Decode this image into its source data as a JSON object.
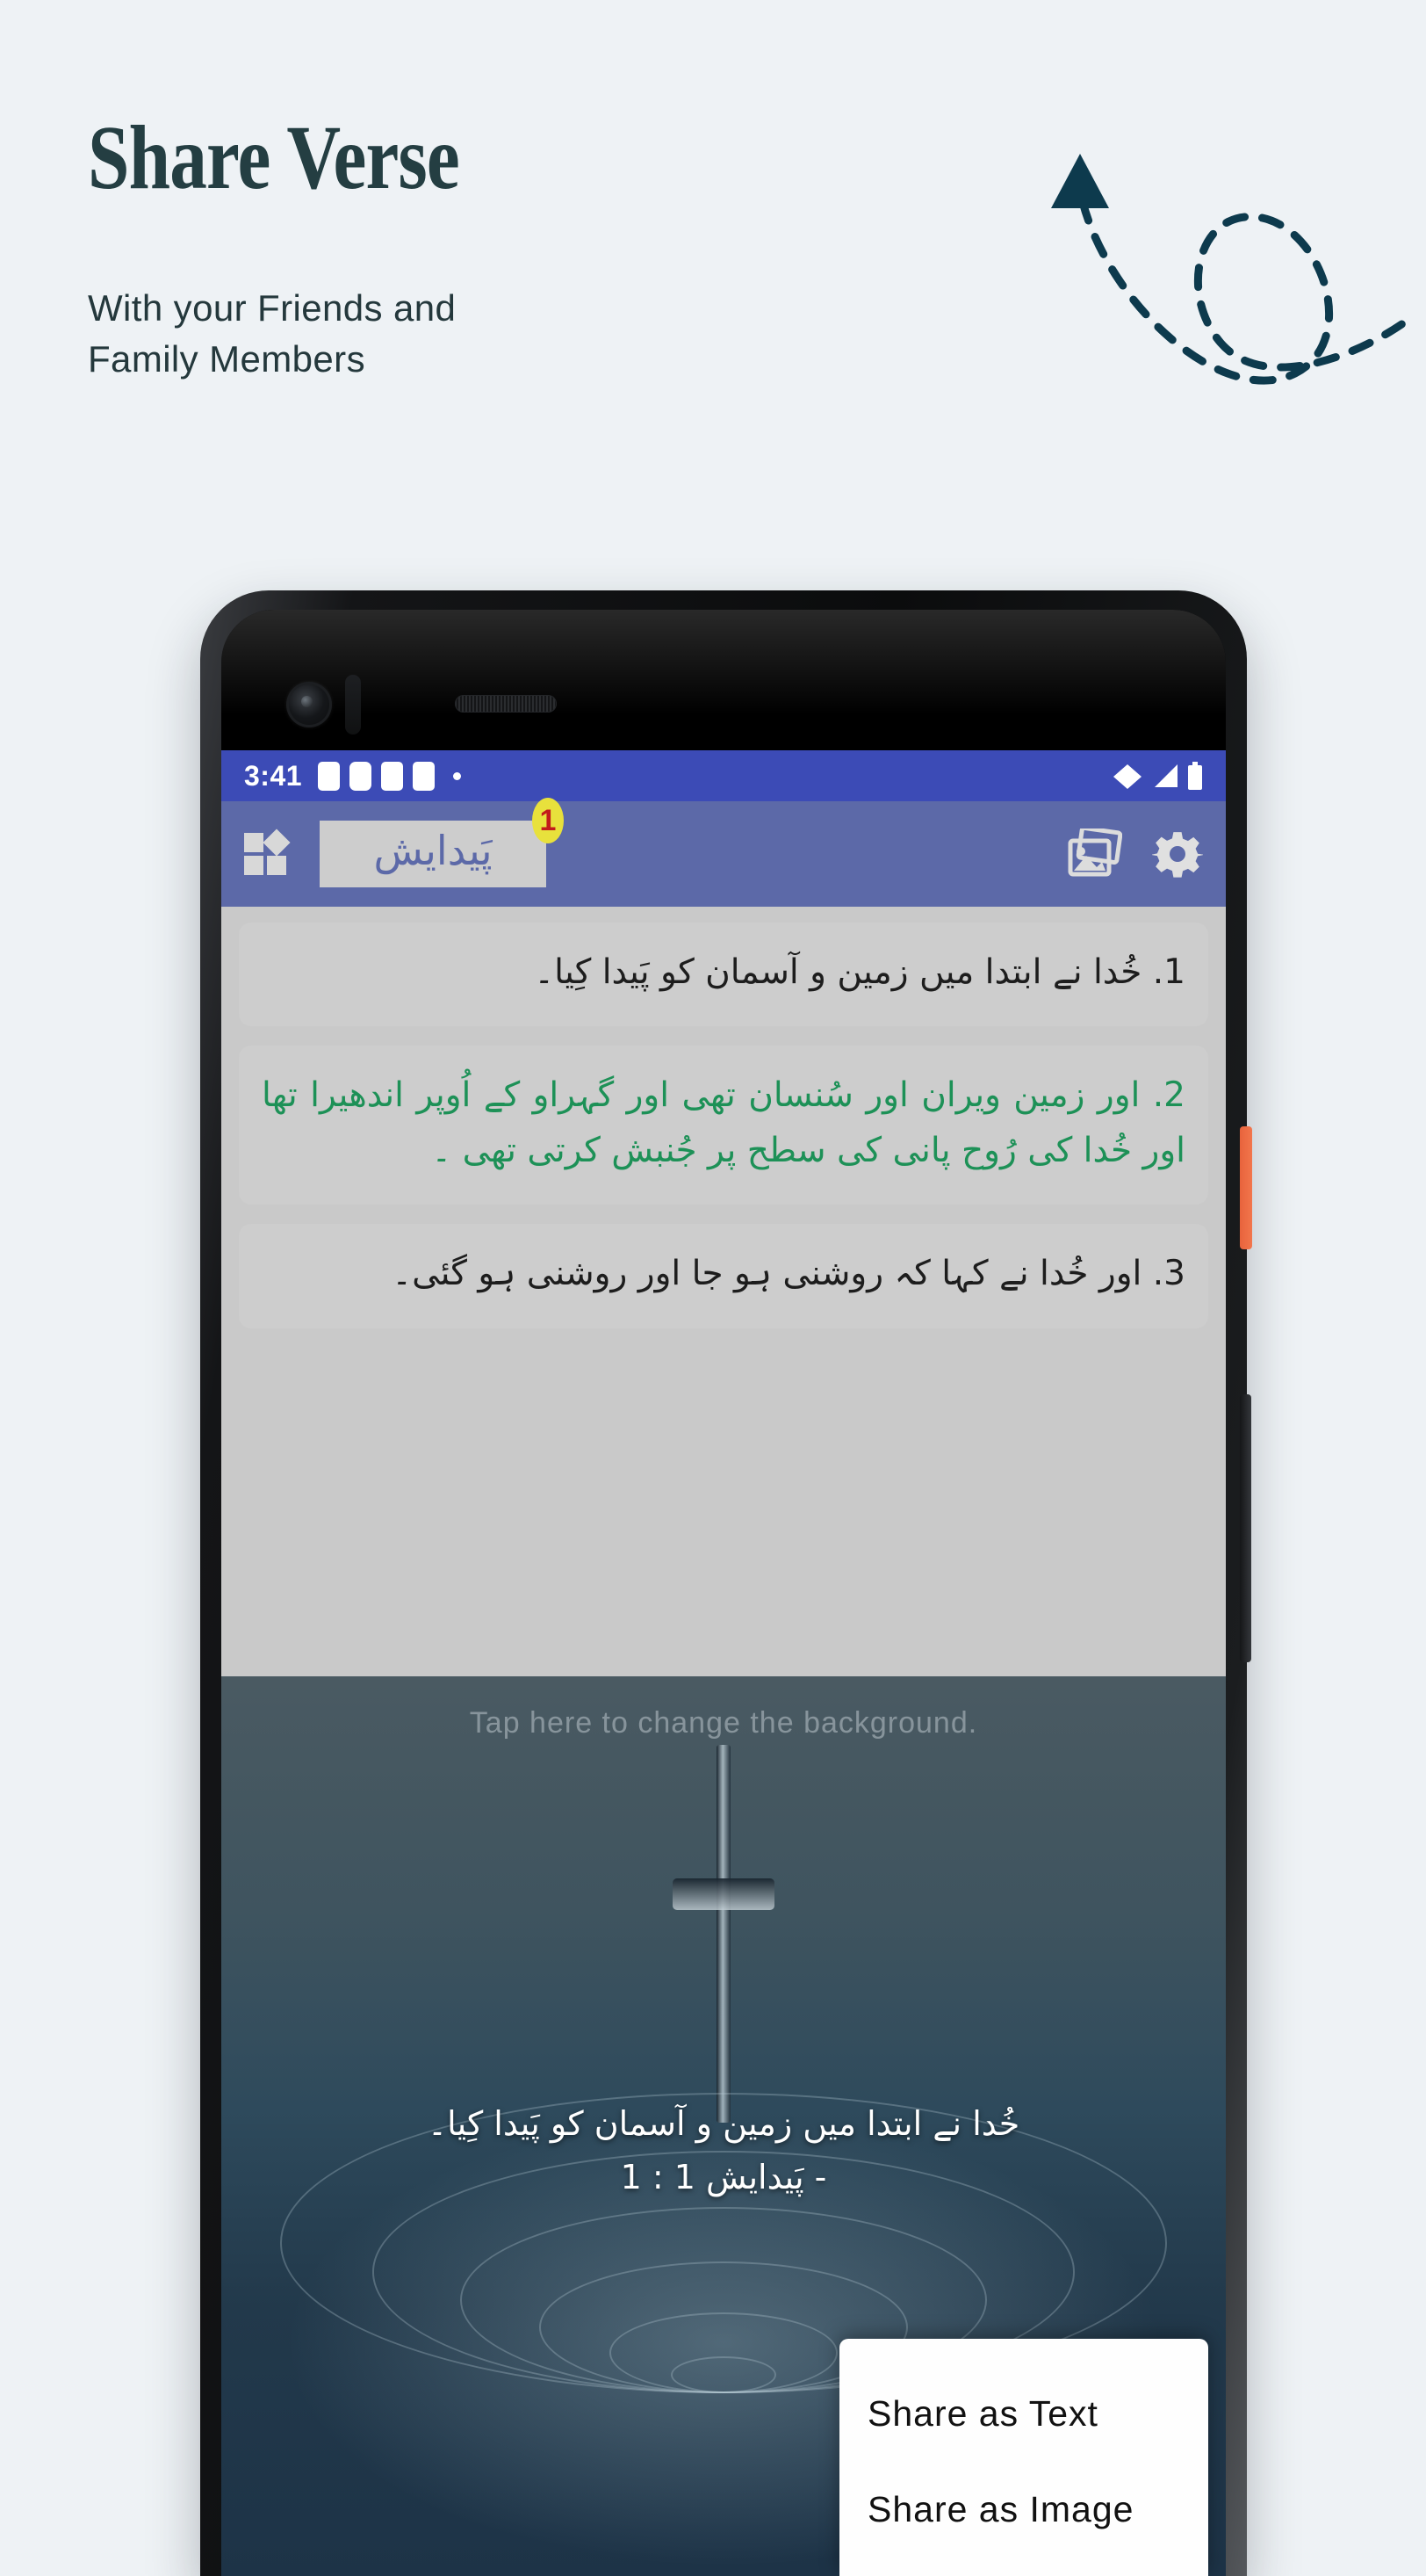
{
  "promo": {
    "title": "Share Verse",
    "subtitle": "With your Friends and\nFamily Members",
    "title_color": "#243e42",
    "background_color": "#eef2f5",
    "arrow_color": "#0d3a4d"
  },
  "phone": {
    "status_bar": {
      "time": "3:41",
      "background_color": "#3c4bb6",
      "notification_icons": [
        "notification-square",
        "notification-square",
        "notification-square",
        "notification-square"
      ],
      "dot_icon": "notification-dot",
      "right_icons": [
        "wifi-icon",
        "signal-icon",
        "battery-icon"
      ]
    },
    "app_bar": {
      "background_color": "#5c69a8",
      "menu_icon": "grid-dashboard-icon",
      "book_chip_label": "پَیدایش",
      "book_chip_badge": "1",
      "badge_background_color": "#e8e13c",
      "badge_text_color": "#c21b1b",
      "gallery_icon": "gallery-image-icon",
      "settings_icon": "gear-icon"
    },
    "verses": [
      {
        "number": "1",
        "text": "‏1. خُدا نے ابتدا میں زمین و آسمان کو پَیدا کِیا۔",
        "highlighted": false
      },
      {
        "number": "2",
        "text": "‏2.   اور زمین ویران اور سُنسان تھی اور گہراو کے اُوپر اندھیرا تھا اور خُدا کی رُوح پانی کی سطح پر جُنبش کرتی تھی ۔",
        "highlighted": true
      },
      {
        "number": "3",
        "text": "‏3. اور خُدا نے کہا کہ روشنی ہو جا اور روشنی ہو گئی۔",
        "highlighted": false
      }
    ],
    "highlight_color": "#1d9157",
    "card_background_color": "#cdcdcd",
    "background_preview": {
      "hint": "Tap here to change the background.",
      "overlay_verse": "‏خُدا نے ابتدا میں زمین و آسمان کو پَیدا کِیا۔",
      "overlay_reference": "- پَیدایش 1 : 1",
      "image_subject": "cross-in-water"
    },
    "share_menu": {
      "items": [
        {
          "label": "Share as Text"
        },
        {
          "label": "Share as Image"
        }
      ]
    },
    "hardware": {
      "power_button_color": "#ef7049",
      "volume_button_color": "#1d1f22"
    }
  }
}
